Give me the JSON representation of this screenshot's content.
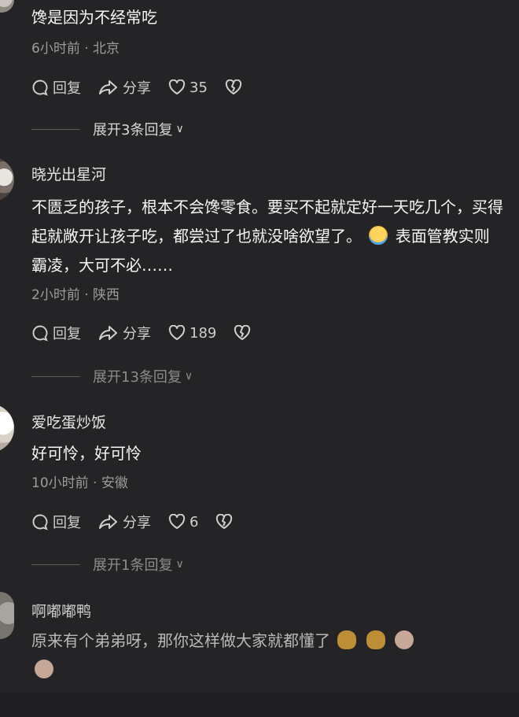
{
  "comments": [
    {
      "username": "",
      "content": "馋是因为不经常吃",
      "meta": "6小时前 · 北京",
      "reply_label": "回复",
      "share_label": "分享",
      "likes": "35",
      "expand_label": "展开3条回复"
    },
    {
      "username": "晓光出星河",
      "content": "不匮乏的孩子，根本不会馋零食。要买不起就定好一天吃几个，买得起就敞开让孩子吃，都尝过了也就没啥欲望了。",
      "content_tail": "表面管教实则霸凌，大可不必……",
      "meta": "2小时前 · 陕西",
      "reply_label": "回复",
      "share_label": "分享",
      "likes": "189",
      "expand_label": "展开13条回复"
    },
    {
      "username": "爱吃蛋炒饭",
      "content": "好可怜，好可怜",
      "meta": "10小时前 · 安徽",
      "reply_label": "回复",
      "share_label": "分享",
      "likes": "6",
      "expand_label": "展开1条回复"
    },
    {
      "username": "啊嘟嘟鸭",
      "content": "原来有个弟弟呀，那你这样做大家就都懂了"
    }
  ],
  "colors": {
    "background": "#242326",
    "text": "#f6f6f6",
    "meta": "#9c9c9c"
  }
}
